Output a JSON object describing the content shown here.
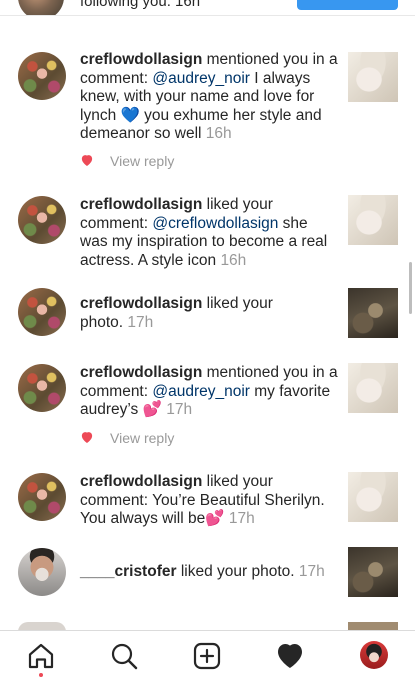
{
  "top_partial": {
    "text": "following you. 16h"
  },
  "notifications": [
    {
      "user": "creflowdollasign",
      "pre": " mentioned you in a comment: ",
      "mention": "@audrey_noir",
      "post": " I always knew, with your name and love for lynch 💙 you exhume her style and demeanor so well ",
      "time": "16h",
      "thumb": "portrait-photo",
      "reply_label": "View reply"
    },
    {
      "user": "creflowdollasign",
      "pre": " liked your comment: ",
      "mention": "@creflowdollasign",
      "post": " she was my inspiration to become a real actress. A style icon ",
      "time": "16h",
      "thumb": "portrait-photo"
    },
    {
      "user": "creflowdollasign",
      "pre": " liked your photo. ",
      "time": "17h",
      "thumb": "dark-photo"
    },
    {
      "user": "creflowdollasign",
      "pre": " mentioned you in a comment: ",
      "mention": "@audrey_noir",
      "post": " my favorite audrey’s 💕 ",
      "time": "17h",
      "thumb": "portrait-photo",
      "reply_label": "View reply"
    },
    {
      "user": "creflowdollasign",
      "pre": " liked your comment: You’re Beautiful Sherilyn. You always will be💕 ",
      "time": "17h",
      "thumb": "portrait-photo"
    },
    {
      "user": "____cristofer",
      "pre": " liked your photo. ",
      "time": "17h",
      "thumb": "dark-photo"
    }
  ],
  "tabbar": {
    "items": [
      {
        "name": "home",
        "icon": "home-icon",
        "active": true
      },
      {
        "name": "search",
        "icon": "search-icon"
      },
      {
        "name": "new-post",
        "icon": "plus-square-icon"
      },
      {
        "name": "activity",
        "icon": "heart-filled-icon"
      },
      {
        "name": "profile",
        "icon": "profile-avatar"
      }
    ]
  },
  "colors": {
    "text": "#262626",
    "mention": "#003569",
    "muted": "#999999",
    "heart": "#ed4956",
    "follow_button": "#3897f0"
  }
}
